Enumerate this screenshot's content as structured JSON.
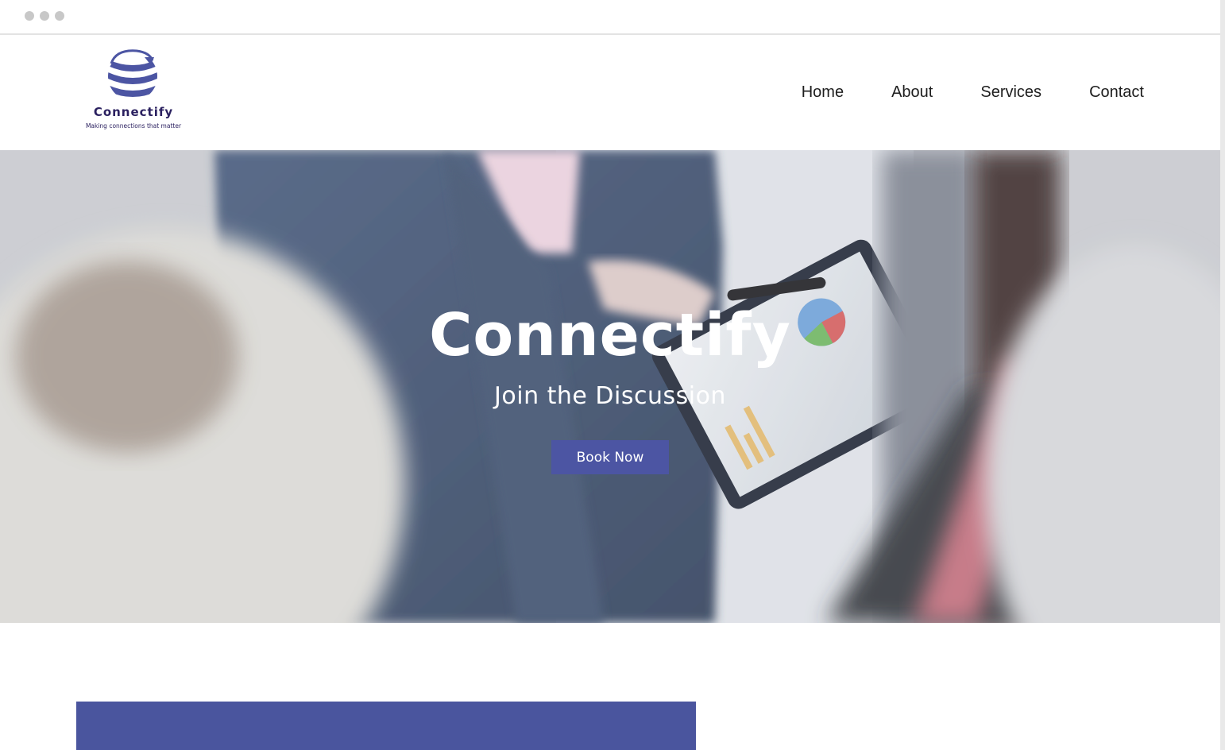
{
  "brand": {
    "name": "Connectify",
    "tagline": "Making connections that matter",
    "primary_color": "#4c55a3",
    "logo_icon": "globe-swirl-icon"
  },
  "nav": {
    "items": [
      {
        "label": "Home"
      },
      {
        "label": "About"
      },
      {
        "label": "Services"
      },
      {
        "label": "Contact"
      }
    ]
  },
  "hero": {
    "title": "Connectify",
    "subtitle": "Join the Discussion",
    "cta_label": "Book Now"
  }
}
